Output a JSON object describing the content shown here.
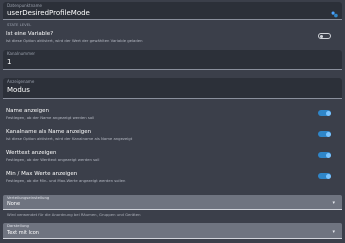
{
  "datapoint": {
    "label": "Datenpunktname",
    "value": "userDesiredProfileMode",
    "sublabel": "STATE LEVEL"
  },
  "is_variable": {
    "title": "Ist eine Variable?",
    "desc": "Ist diese Option aktiviert, wird der Wert der gewählten Variable geladen",
    "on": false
  },
  "channel_number": {
    "label": "Kanalnummer",
    "value": "1"
  },
  "display_name": {
    "label": "Anzeigename",
    "value": "Modus"
  },
  "show_name": {
    "title": "Name anzeigen",
    "desc": "Festlegen, ob der Name angezeigt werden soll",
    "on": true
  },
  "channel_as_name": {
    "title": "Kanalname als Name anzeigen",
    "desc": "Ist diese Option aktiviert, wird der Kanalname als Name angezeigt",
    "on": true
  },
  "show_value_text": {
    "title": "Werttext anzeigen",
    "desc": "Festlegen, ob der Werttext angezeigt werden soll",
    "on": true
  },
  "show_min_max": {
    "title": "Min / Max Werte anzeigen",
    "desc": "Festlegen, ob die Min- und Max-Werte angezeigt werden sollen",
    "on": true
  },
  "visibility": {
    "label": "Verteilungseinstellung",
    "value": "None",
    "hint": "Wird verwendet für die Anordnung bei Räumen, Gruppen und Geräten"
  },
  "display": {
    "label": "Darstellung",
    "value": "Text mit Icon"
  },
  "colors": {
    "accent": "#2f86c9",
    "bg": "#3b3f4a"
  }
}
